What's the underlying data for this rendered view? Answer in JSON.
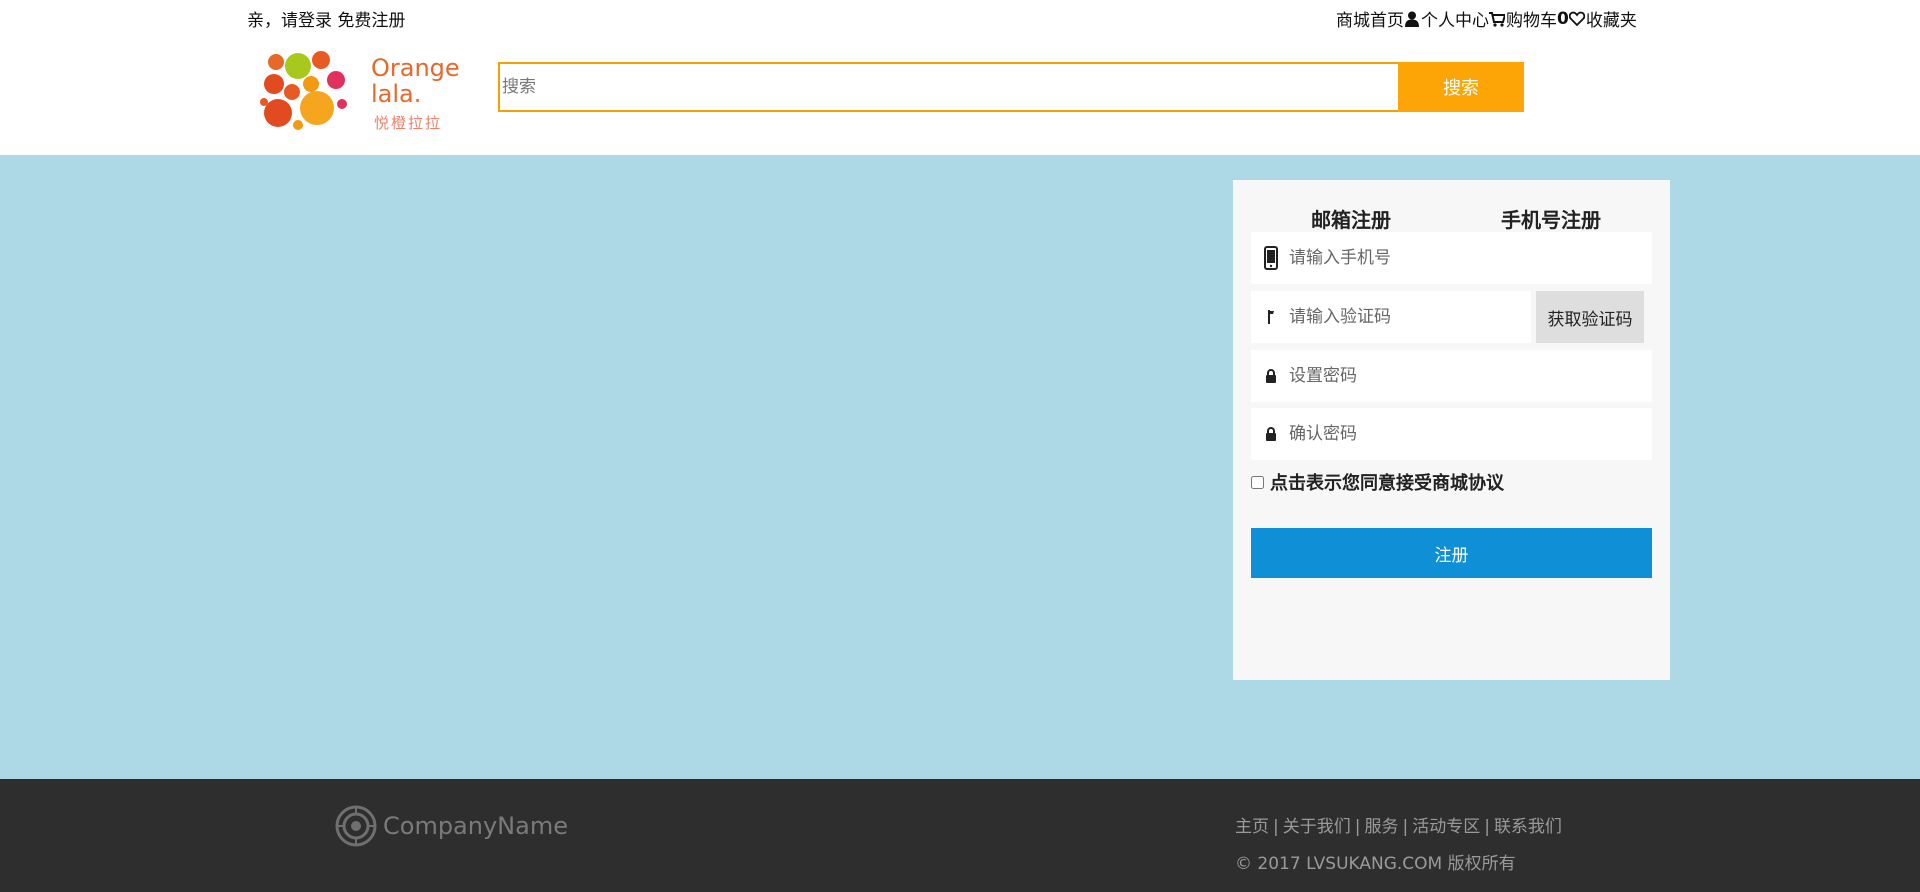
{
  "topbar": {
    "greeting": "亲，请登录",
    "register": "免费注册",
    "home": "商城首页",
    "user_center": "个人中心",
    "cart": "购物车",
    "cart_count": "0",
    "favorites": "收藏夹"
  },
  "logo": {
    "line1": "Orange",
    "line2": "lala.",
    "chinese": "悦橙拉拉"
  },
  "search": {
    "placeholder": "搜索",
    "button": "搜索"
  },
  "register_form": {
    "tabs": [
      "邮箱注册",
      "手机号注册"
    ],
    "phone_placeholder": "请输入手机号",
    "code_placeholder": "请输入验证码",
    "get_code_button": "获取验证码",
    "password_placeholder": "设置密码",
    "confirm_placeholder": "确认密码",
    "agreement": "点击表示您同意接受商城协议",
    "submit": "注册"
  },
  "footer": {
    "company": "CompanyName",
    "links": [
      "主页",
      "关于我们",
      "服务",
      "活动专区",
      "联系我们"
    ],
    "separator": "|",
    "copyright": "© 2017 LVSUKANG.COM 版权所有"
  },
  "colors": {
    "main_bg": "#add8e6",
    "search_accent": "#fda506",
    "submit": "#0f8fd6",
    "footer_bg": "#2e2e2e"
  },
  "icons": [
    "user-icon",
    "cart-icon",
    "heart-icon",
    "phone-icon",
    "key-icon",
    "lock-icon",
    "company-logo-icon"
  ]
}
